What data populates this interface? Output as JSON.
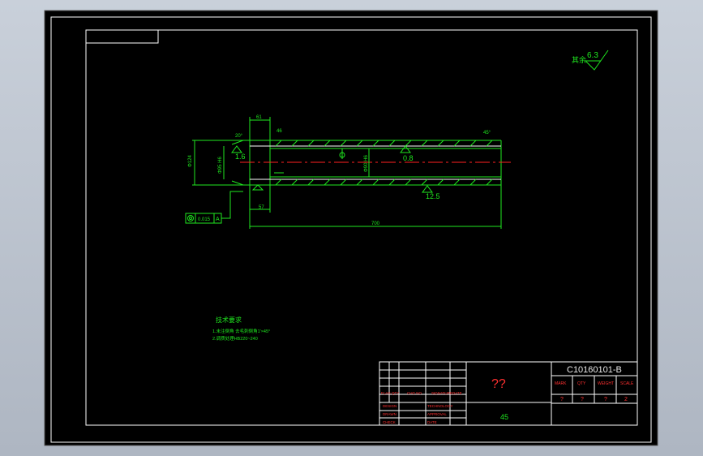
{
  "drawing": {
    "surface_finish": {
      "label": "其余",
      "value": "6.3"
    },
    "roughness_marks": [
      "1.6",
      "0.8",
      "12.5"
    ],
    "dimensions": {
      "top_width": "61",
      "top_small": "46",
      "left_angle": "20°",
      "right_angle": "45°",
      "outer_dia": "Φ124",
      "inner_dia_left": "Φ95 H6",
      "inner_dia_mid": "Φ90 H6",
      "step_len": "57",
      "total_len": "700"
    },
    "tolerance": {
      "value": "0.015",
      "datum": "A"
    },
    "tech_req": {
      "title": "技术要求",
      "lines": [
        "1.未注倒角 去毛刺倒角1'×45°",
        "2.调质处理HB220~240"
      ]
    }
  },
  "title_block": {
    "drawing_number": "C10160101-B",
    "part_name": "??",
    "material": "45",
    "header_cols": [
      "MARK",
      "QTY",
      "WEIGHT",
      "SCALE"
    ],
    "header_vals": [
      "?",
      "?",
      "?",
      "2"
    ],
    "left_labels": [
      "DESIGN",
      "DRAWN",
      "CHECK"
    ],
    "mid_labels": [
      "TECHNOLOGY",
      "APPROVAL",
      "DATE"
    ],
    "row_labels": [
      "FLAG",
      "QTY",
      "CHG NO",
      "SIGNATURE",
      "DATE"
    ]
  },
  "colors": {
    "background": "#000000",
    "lines": "#1fe81f",
    "frame": "#ffffff",
    "centerline": "#ff2020",
    "labels": "#ff3030"
  }
}
